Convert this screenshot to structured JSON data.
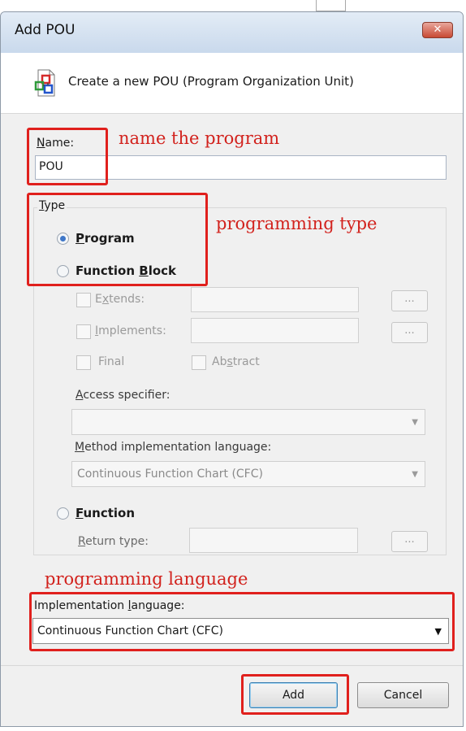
{
  "window": {
    "title": "Add POU",
    "close_glyph": "✕"
  },
  "header": {
    "description": "Create a new POU (Program Organization Unit)",
    "icon": "pou-icon"
  },
  "name_field": {
    "label_first": "N",
    "label_rest": "ame:",
    "value": "POU"
  },
  "type_group": {
    "label_first": "T",
    "label_rest": "ype",
    "program": {
      "label_first": "P",
      "label_rest": "rogram",
      "selected": true
    },
    "function_block": {
      "label_pre": "Function ",
      "label_u": "B",
      "label_post": "lock",
      "selected": false
    },
    "extends": {
      "label_pre": "E",
      "label_u": "x",
      "label_post": "tends:",
      "browse": "..."
    },
    "implements": {
      "label_first": "I",
      "label_rest": "mplements:",
      "browse": "..."
    },
    "final_label": "Final",
    "abstract": {
      "label_pre": "Ab",
      "label_u": "s",
      "label_post": "tract"
    },
    "access_specifier": {
      "label_first": "A",
      "label_rest": "ccess specifier:",
      "value": ""
    },
    "method_language": {
      "label_first": "M",
      "label_rest": "ethod implementation language:",
      "value": "Continuous Function Chart (CFC)"
    },
    "function": {
      "label_first": "F",
      "label_rest": "unction",
      "selected": false
    },
    "return_type": {
      "label_first": "R",
      "label_rest": "eturn type:",
      "browse": "..."
    }
  },
  "implementation_language": {
    "label_pre": "Implementation ",
    "label_u": "l",
    "label_post": "anguage:",
    "value": "Continuous Function Chart (CFC)"
  },
  "buttons": {
    "add": "Add",
    "cancel": "Cancel"
  },
  "annotations": {
    "name": "name the program",
    "type": "programming type",
    "language": "programming language",
    "color": "#e0201d"
  }
}
